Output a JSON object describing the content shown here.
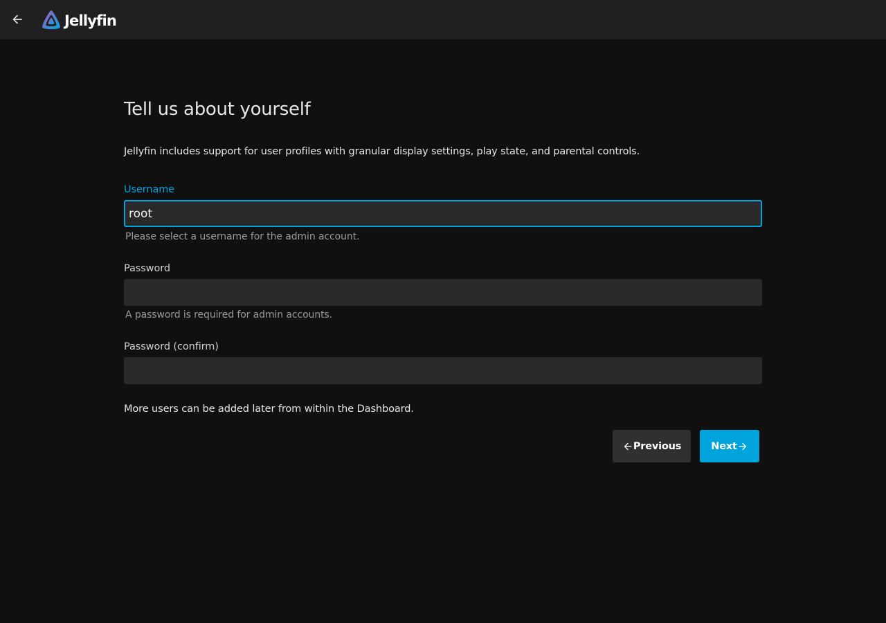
{
  "header": {
    "back_icon": "arrow-left-icon",
    "app_name": "Jellyfin",
    "logo_colors": [
      "#aa5cc3",
      "#00a4dc"
    ]
  },
  "page": {
    "title": "Tell us about yourself",
    "intro": "Jellyfin includes support for user profiles with granular display settings, play state, and parental controls.",
    "footer_note": "More users can be added later from within the Dashboard."
  },
  "form": {
    "username": {
      "label": "Username",
      "value": "root",
      "help": "Please select a username for the admin account."
    },
    "password": {
      "label": "Password",
      "value": "",
      "help": "A password is required for admin accounts."
    },
    "password_confirm": {
      "label": "Password (confirm)",
      "value": ""
    }
  },
  "buttons": {
    "previous": "Previous",
    "next": "Next"
  },
  "colors": {
    "accent": "#00a4dc",
    "background": "#101010",
    "header": "#202020",
    "input": "#292929",
    "secondary_button": "#303030"
  }
}
